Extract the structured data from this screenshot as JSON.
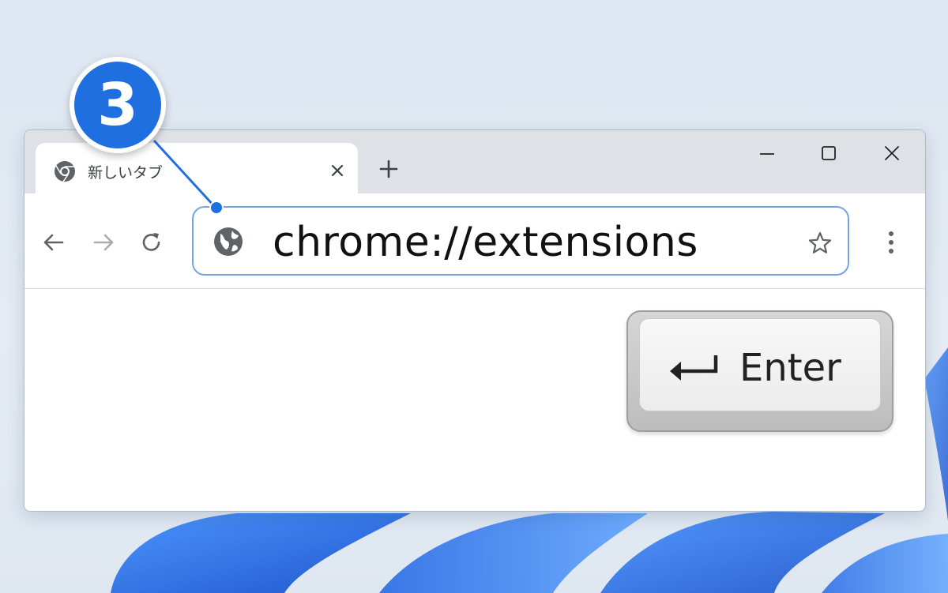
{
  "colors": {
    "accent": "#1f6fe0",
    "omnibox_border": "#76a3e0",
    "tabstrip_bg": "#dee1e6",
    "wallpaper_blue": "#1a5fd6"
  },
  "step": {
    "number": "3"
  },
  "browser": {
    "tab": {
      "title": "新しいタブ",
      "favicon": "chrome-icon",
      "close_icon": "close-icon"
    },
    "new_tab_icon": "plus-icon",
    "window_controls": [
      "minimize-icon",
      "maximize-icon",
      "close-icon"
    ],
    "nav": [
      "back-arrow-icon",
      "forward-arrow-icon",
      "reload-icon"
    ],
    "omnibox": {
      "url": "chrome://extensions",
      "site_icon": "globe-icon",
      "bookmark_icon": "star-icon"
    },
    "menu_icon": "kebab-menu-icon"
  },
  "key": {
    "label": "Enter",
    "icon": "return-arrow-icon"
  }
}
